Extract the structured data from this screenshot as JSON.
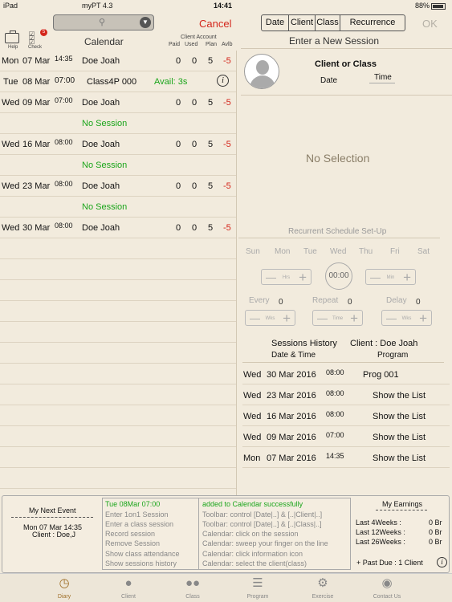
{
  "statusbar": {
    "device": "iPad",
    "app": "myPT 4.3",
    "time": "14:41",
    "battery": "88%"
  },
  "toolbar": {
    "cancel_label": "Cancel",
    "ok_label": "OK",
    "segments": [
      "Date",
      "Client",
      "Class",
      "Recurrence"
    ]
  },
  "left_header": {
    "help_label": "Help",
    "check_label": "Check",
    "check_badge": "5",
    "calendar_title": "Calendar",
    "client_account_label": "Client Account",
    "col_paid": "Paid",
    "col_used": "Used",
    "col_plan": "Plan",
    "col_avlb": "Avlb"
  },
  "calendar": {
    "rows": [
      {
        "day": "Mon",
        "date": "07 Mar",
        "time": "14:35",
        "name": "Doe Joah",
        "paid": "0",
        "used": "0",
        "plan": "5",
        "avlb": "-5"
      },
      {
        "day": "Tue",
        "date": "08 Mar",
        "time": "07:00",
        "name": "Class4P 000",
        "avail": "Avail: 3s",
        "info": "i"
      },
      {
        "day": "Wed",
        "date": "09 Mar",
        "time": "07:00",
        "name": "Doe Joah",
        "paid": "0",
        "used": "0",
        "plan": "5",
        "avlb": "-5"
      },
      {
        "no_session": "No Session"
      },
      {
        "day": "Wed",
        "date": "16 Mar",
        "time": "08:00",
        "name": "Doe Joah",
        "paid": "0",
        "used": "0",
        "plan": "5",
        "avlb": "-5"
      },
      {
        "no_session": "No Session"
      },
      {
        "day": "Wed",
        "date": "23 Mar",
        "time": "08:00",
        "name": "Doe Joah",
        "paid": "0",
        "used": "0",
        "plan": "5",
        "avlb": "-5"
      },
      {
        "no_session": "No Session"
      },
      {
        "day": "Wed",
        "date": "30 Mar",
        "time": "08:00",
        "name": "Doe Joah",
        "paid": "0",
        "used": "0",
        "plan": "5",
        "avlb": "-5"
      }
    ]
  },
  "session_panel": {
    "title": "Enter a New Session",
    "client_or_class": "Client or Class",
    "date_label": "Date",
    "time_label": "Time",
    "no_selection": "No Selection"
  },
  "recurrence": {
    "title": "Recurrent Schedule Set-Up",
    "weekdays": [
      "Sun",
      "Mon",
      "Tue",
      "Wed",
      "Thu",
      "Fri",
      "Sat"
    ],
    "hrs_label": "Hrs",
    "min_label": "Min",
    "clock": "00:00",
    "every_label": "Every",
    "every_value": "0",
    "repeat_label": "Repeat",
    "repeat_value": "0",
    "delay_label": "Delay",
    "delay_value": "0",
    "wks_label": "Wks",
    "time_label": "Time"
  },
  "history": {
    "title": "Sessions History",
    "client": "Client : Doe Joah",
    "col_date_time": "Date  &  Time",
    "col_program": "Program",
    "rows": [
      {
        "day": "Wed",
        "date": "30 Mar 2016",
        "time": "08:00",
        "program": "Prog 001"
      },
      {
        "day": "Wed",
        "date": "23 Mar 2016",
        "time": "08:00",
        "program": "Show the List"
      },
      {
        "day": "Wed",
        "date": "16 Mar 2016",
        "time": "08:00",
        "program": "Show the List"
      },
      {
        "day": "Wed",
        "date": "09 Mar 2016",
        "time": "07:00",
        "program": "Show the List"
      },
      {
        "day": "Mon",
        "date": "07 Mar 2016",
        "time": "14:35",
        "program": "Show the List"
      }
    ]
  },
  "next_event": {
    "title": "My Next Event",
    "date": "Mon 07 Mar  14:35",
    "client": "Client : Doe,J"
  },
  "log": {
    "left": [
      "Tue 08Mar 07:00",
      "Enter 1on1 Session",
      "Enter a class session",
      "Record session",
      "Remove Session",
      "Show class attendance",
      "Show sessions history"
    ],
    "right": [
      "added to Calendar successfully",
      "Toolbar: control [Date|..] & [..|Client|..]",
      "Toolbar: control [Date|..] & [..|Class|..]",
      "Calendar: click on the session",
      "Calendar: sweep your finger on the line",
      "Calendar: click information icon",
      "Calendar: select the client(class)"
    ],
    "highlight_color": "#1aa51a"
  },
  "earnings": {
    "title": "My Earnings",
    "rows": [
      {
        "label": "Last  4Weeks :",
        "value": "0  Br"
      },
      {
        "label": "Last 12Weeks :",
        "value": "0  Br"
      },
      {
        "label": "Last 26Weeks :",
        "value": "0  Br"
      }
    ],
    "past_due": "+ Past Due : 1 Client"
  },
  "tabs": [
    {
      "label": "Diary",
      "icon": "clock-icon",
      "active": true
    },
    {
      "label": "Client",
      "icon": "person-icon"
    },
    {
      "label": "Class",
      "icon": "group-icon"
    },
    {
      "label": "Program",
      "icon": "list-icon"
    },
    {
      "label": "Exercise",
      "icon": "weight-icon"
    },
    {
      "label": "Contact Us",
      "icon": "globe-icon"
    }
  ]
}
